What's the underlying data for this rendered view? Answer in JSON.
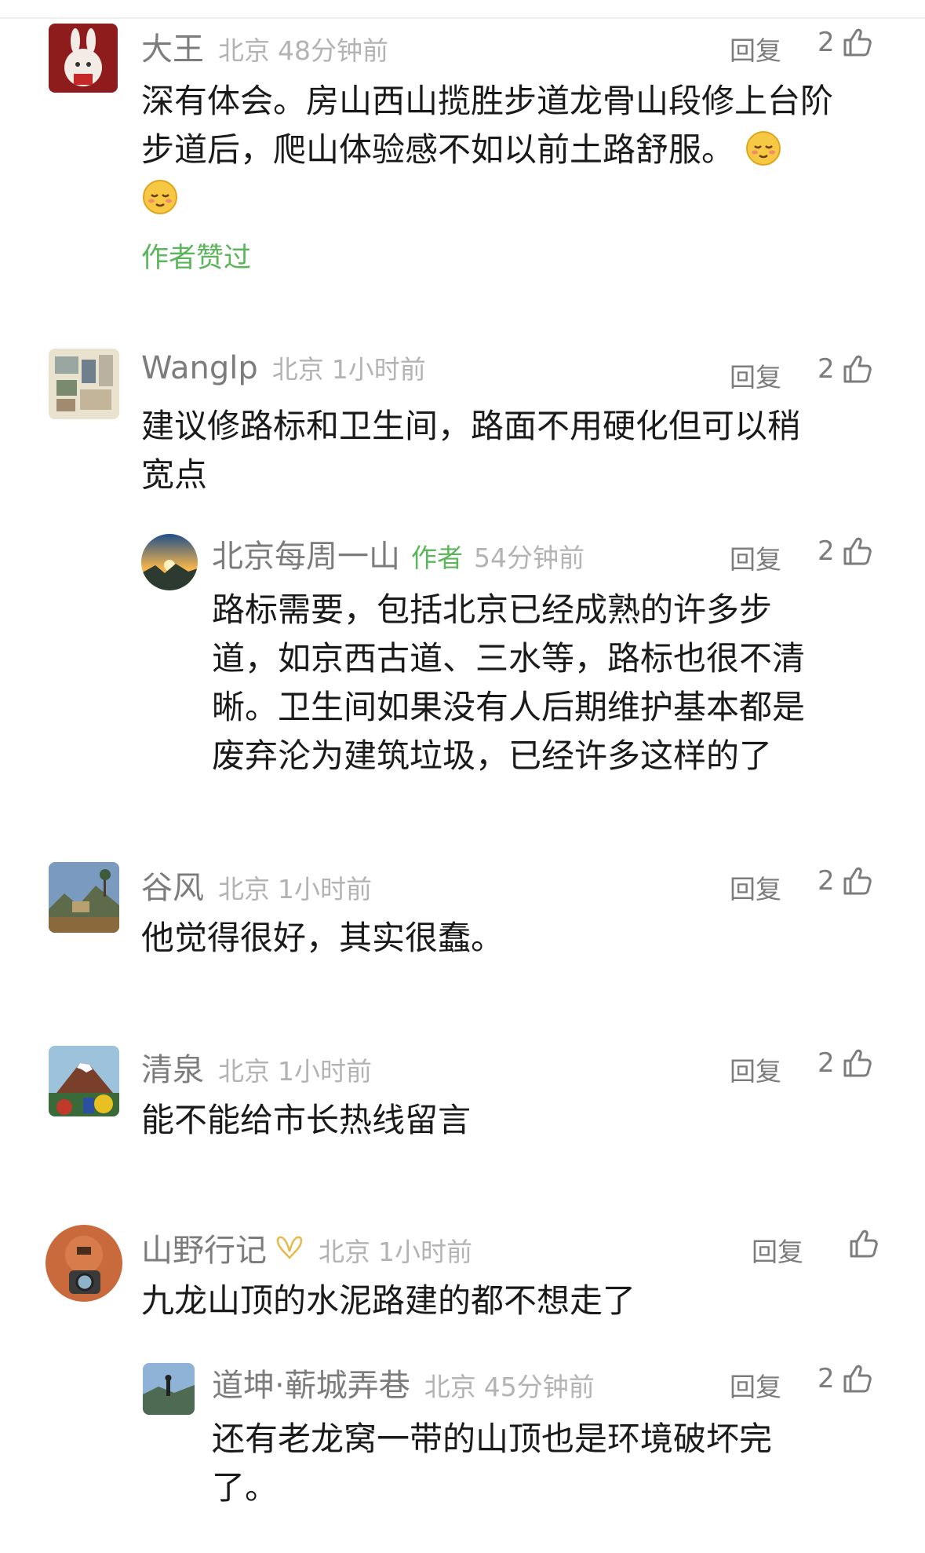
{
  "comments": [
    {
      "name": "大王",
      "location": "北京",
      "time": "48分钟前",
      "reply": "回复",
      "likes": "2",
      "text": "深有体会。房山西山揽胜步道龙骨山段修上台阶步道后，爬山体验感不如以前土路舒服。",
      "liked_by_author": "作者赞过",
      "avatar_icon": "rabbit-avatar-icon"
    },
    {
      "name": "Wanglp",
      "location": "北京",
      "time": "1小时前",
      "reply": "回复",
      "likes": "2",
      "text_line1": "建议修路标和卫生间，路面不用硬化但可以稍",
      "text_line2": "宽点",
      "avatar_icon": "collage-avatar-icon"
    },
    {
      "name": "北京每周一山",
      "author_tag": "作者",
      "time": "54分钟前",
      "reply": "回复",
      "likes": "2",
      "text_line1": "路标需要，包括北京已经成熟的许多步",
      "text_line2": "道，如京西古道、三水等，路标也很不清",
      "text_line3": "晰。卫生间如果没有人后期维护基本都是",
      "text_line4": "废弃沦为建筑垃圾，已经许多这样的了",
      "avatar_icon": "mountain-sunrise-avatar-icon"
    },
    {
      "name": "谷风",
      "location": "北京",
      "time": "1小时前",
      "reply": "回复",
      "likes": "2",
      "text": "他觉得很好，其实很蠢。",
      "avatar_icon": "landscape-avatar-icon"
    },
    {
      "name": "清泉",
      "location": "北京",
      "time": "1小时前",
      "reply": "回复",
      "likes": "2",
      "text": "能不能给市长热线留言",
      "avatar_icon": "volcano-avatar-icon"
    },
    {
      "name": "山野行记",
      "location": "北京",
      "time": "1小时前",
      "reply": "回复",
      "likes": "",
      "text": "九龙山顶的水泥路建的都不想走了",
      "avatar_icon": "camera-avatar-icon",
      "badge_icon": "verified-badge-icon"
    },
    {
      "name": "道坤·蕲城弄巷",
      "location": "北京",
      "time": "45分钟前",
      "reply": "回复",
      "likes": "2",
      "text_line1": "还有老龙窝一带的山顶也是环境破坏完",
      "text_line2": "了。",
      "avatar_icon": "hiker-avatar-icon"
    }
  ],
  "colors": {
    "green": "#5bb55b",
    "name_gray": "#7c7c7c",
    "info_gray": "#b3b3b3",
    "text": "#1a1a1a"
  }
}
